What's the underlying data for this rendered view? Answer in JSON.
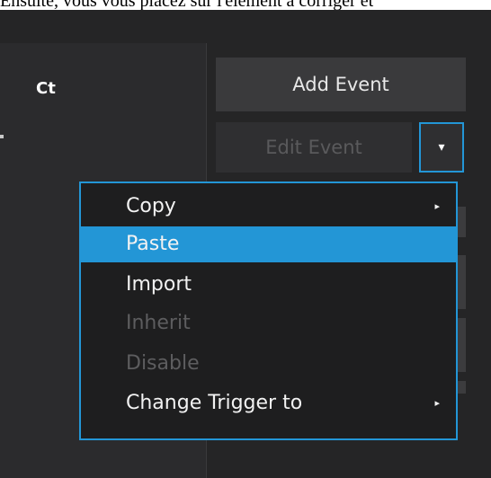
{
  "caption": "Ensuite, vous vous placez sur l'élément à corriger et",
  "panel": {
    "column_header": "Ct"
  },
  "buttons": {
    "add_event": "Add Event",
    "edit_event": "Edit Event",
    "dropdown_arrow": "▾"
  },
  "context_menu": {
    "items": [
      {
        "label": "Copy",
        "submenu_arrow": "▸",
        "state": "normal"
      },
      {
        "label": "Paste",
        "state": "highlighted"
      },
      {
        "label": "Import",
        "state": "normal"
      },
      {
        "label": "Inherit",
        "state": "disabled"
      },
      {
        "label": "Disable",
        "state": "disabled"
      },
      {
        "label": "Change Trigger to",
        "submenu_arrow": "▸",
        "state": "normal"
      }
    ]
  },
  "colors": {
    "accent": "#2396d6",
    "background": "#252526",
    "menu_background": "#1e1e1f",
    "disabled_text": "#5d5d5f"
  }
}
